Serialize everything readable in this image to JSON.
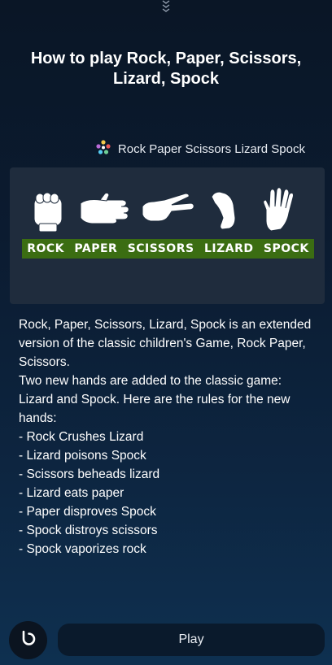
{
  "header": {
    "collapse_icon": "chevron-down-icon",
    "title": "How to play Rock, Paper, Scissors, Lizard, Spock"
  },
  "source": {
    "icon": "app-logo-icon",
    "label": "Rock Paper Scissors Lizard Spock"
  },
  "illustration": {
    "labels": [
      "ROCK",
      "PAPER",
      "SCISSORS",
      "LIZARD",
      "SPOCK"
    ],
    "bar_color": "#3b6d12"
  },
  "body": {
    "intro": "Rock, Paper, Scissors, Lizard, Spock is an extended version of the classic children's Game, Rock Paper, Scissors.",
    "rules_intro": "Two new hands are added to the classic game: Lizard and Spock. Here are the rules for the new hands:",
    "rules": [
      "- Rock Crushes Lizard",
      "- Lizard poisons Spock",
      "- Scissors beheads lizard",
      "- Lizard eats paper",
      "- Paper disproves Spock",
      "- Spock distroys scissors",
      "- Spock vaporizes rock"
    ]
  },
  "footer": {
    "assistant_icon": "bixby-icon",
    "play_label": "Play"
  }
}
